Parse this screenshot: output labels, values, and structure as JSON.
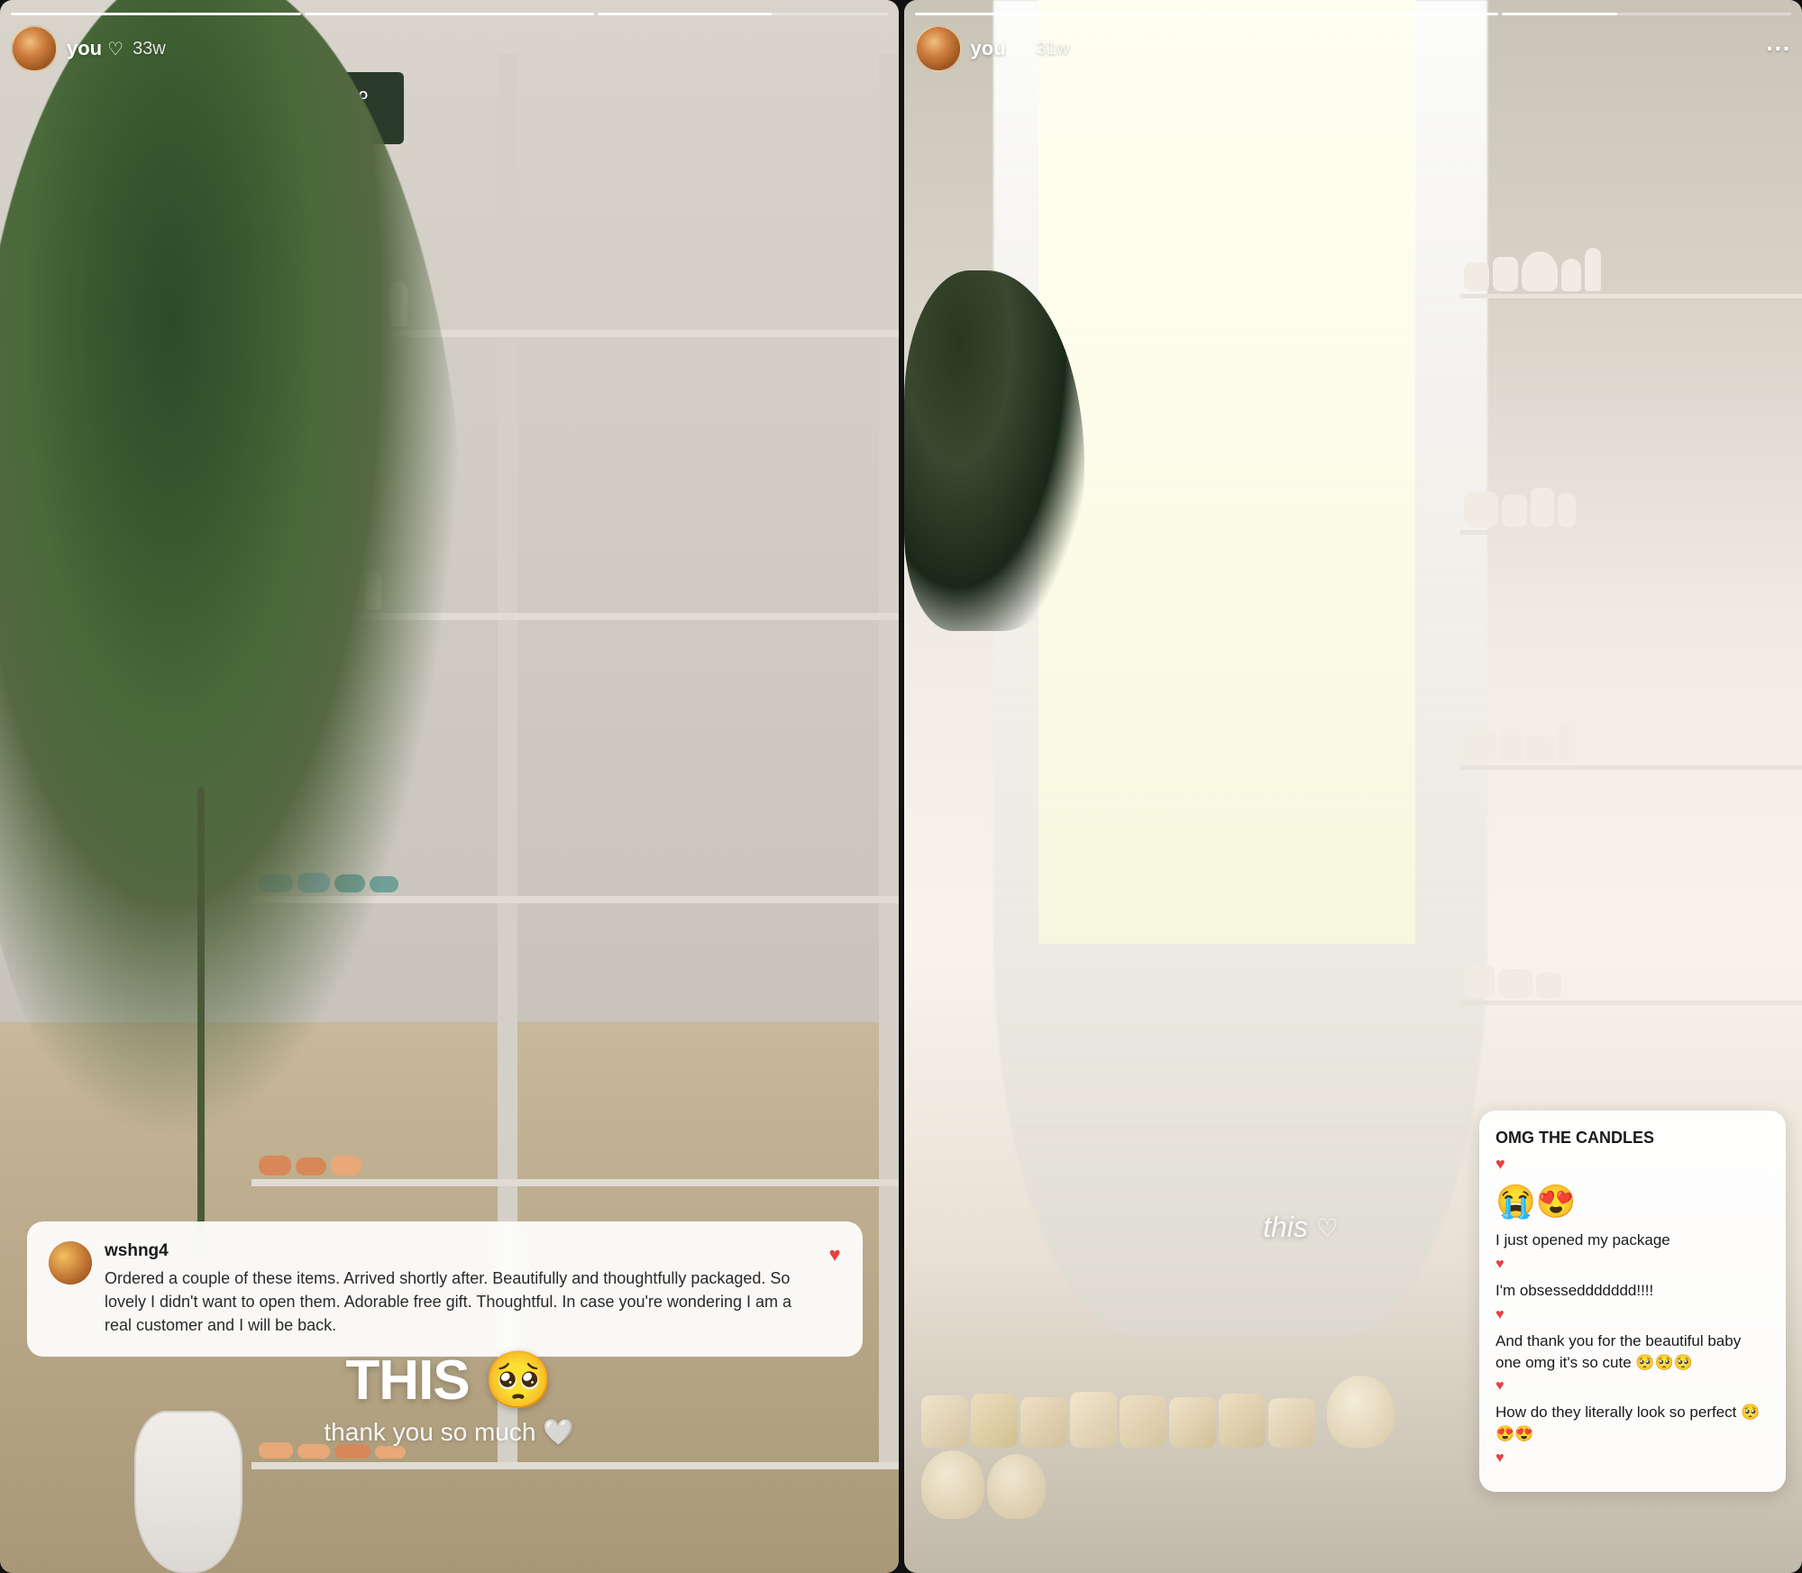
{
  "stories": [
    {
      "id": "story1",
      "progress_segments": [
        {
          "filled": 100
        },
        {
          "filled": 100
        },
        {
          "filled": 60
        }
      ],
      "username": "you",
      "heart": "♡",
      "time_ago": "33w",
      "review": {
        "reviewer_username": "wshng4",
        "text": "Ordered a couple of these items. Arrived shortly after. Beautifully and thoughtfully packaged. So lovely I didn't want to open them. Adorable free gift. Thoughtful. In case you're wondering I am a real customer and I will be back.",
        "heart": "♥"
      },
      "overlay_big": "THIS 🥺",
      "overlay_sub": "thank you so much 🤍"
    },
    {
      "id": "story2",
      "progress_segments": [
        {
          "filled": 100
        },
        {
          "filled": 100
        },
        {
          "filled": 40
        }
      ],
      "username": "you",
      "heart": "♡",
      "time_ago": "31w",
      "this_label": "this",
      "this_heart": "♡",
      "chat": {
        "heading": "OMG THE CANDLES",
        "heart1": "♥",
        "emojis": "😭😍",
        "messages": [
          {
            "text": "I just opened my package",
            "heart": "♥"
          },
          {
            "text": "I'm obsesseddddddd!!!!",
            "heart": "♥"
          },
          {
            "text": "And thank you for the beautiful baby one omg it's so cute 🥺🥺🥺",
            "heart": "♥"
          },
          {
            "text": "How do they literally look so perfect 🥺😍😍",
            "heart": "♥"
          }
        ]
      }
    }
  ],
  "icons": {
    "more_dots": "···",
    "heart_filled": "♥",
    "heart_outline": "♡"
  }
}
